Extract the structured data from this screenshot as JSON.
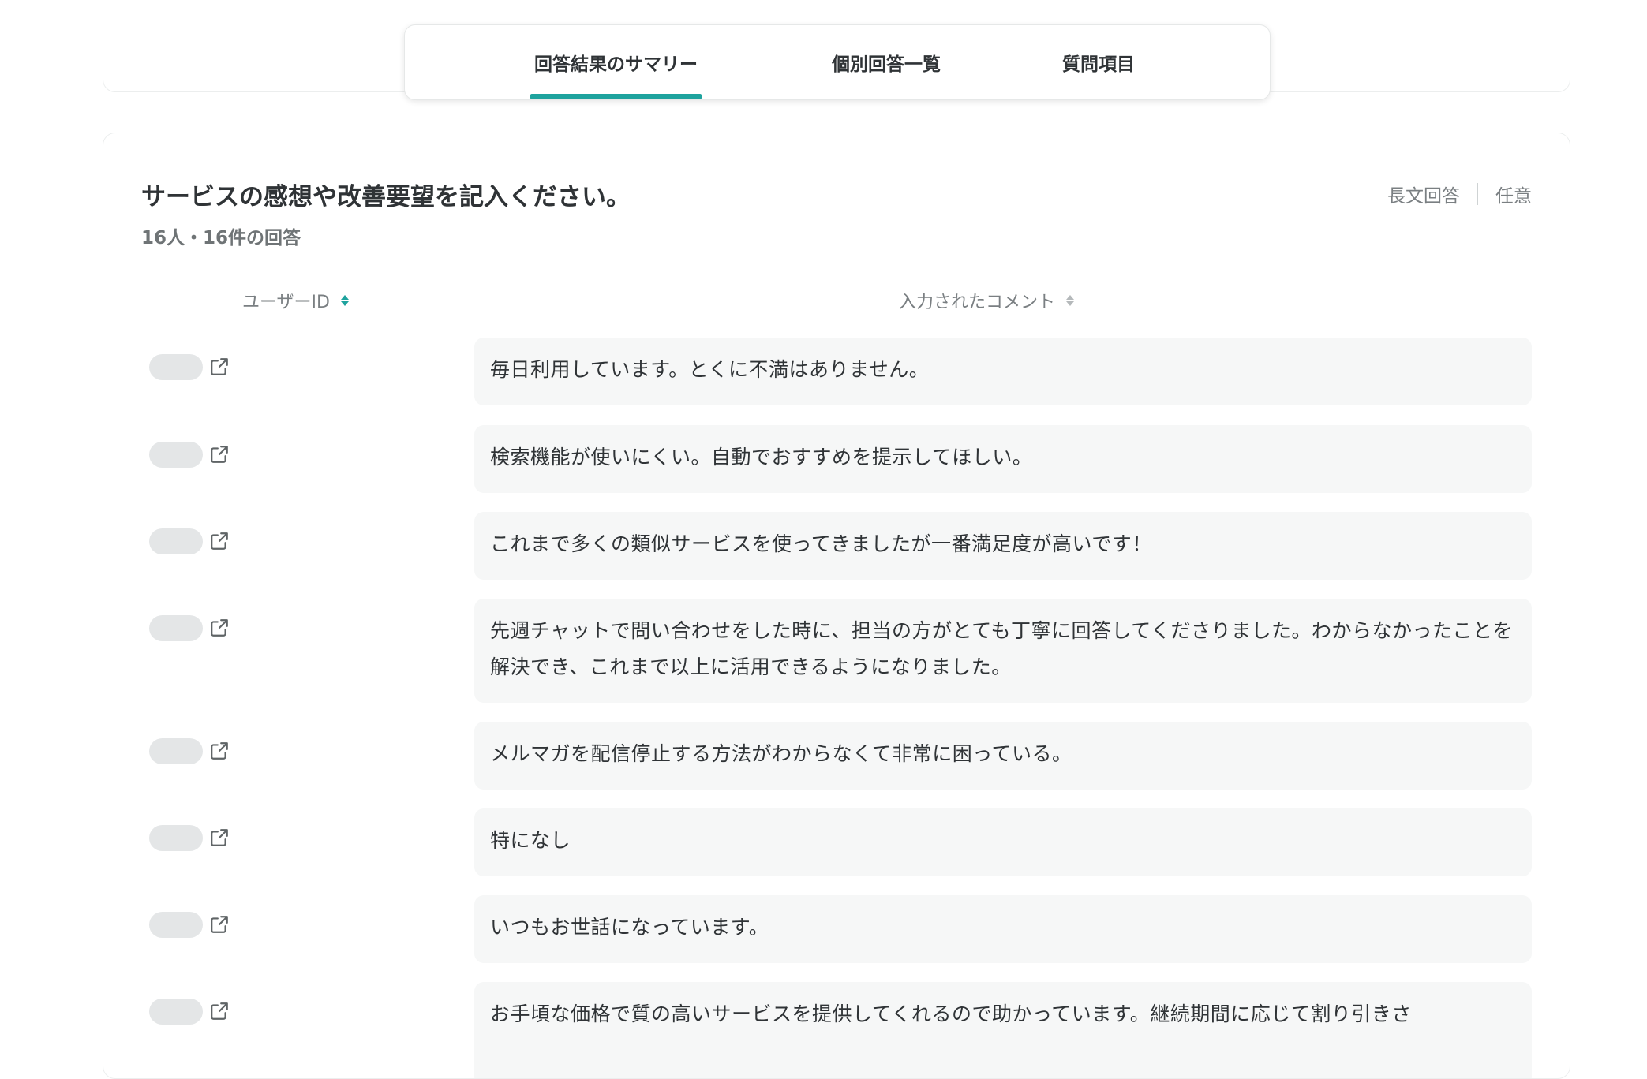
{
  "tabs": [
    {
      "label": "回答結果のサマリー",
      "active": true
    },
    {
      "label": "個別回答一覧",
      "active": false
    },
    {
      "label": "質問項目",
      "active": false
    }
  ],
  "question": {
    "title": "サービスの感想や改善要望を記入ください。",
    "count": "16人・16件の回答",
    "type": "長文回答",
    "required": "任意"
  },
  "columns": {
    "user_id": "ユーザーID",
    "comment": "入力されたコメント"
  },
  "rows": [
    {
      "comment": "毎日利用しています。とくに不満はありません。"
    },
    {
      "comment": "検索機能が使いにくい。自動でおすすめを提示してほしい。"
    },
    {
      "comment": "これまで多くの類似サービスを使ってきましたが一番満足度が高いです！"
    },
    {
      "comment": "先週チャットで問い合わせをした時に、担当の方がとても丁寧に回答してくださりました。わからなかったことを解決でき、これまで以上に活用できるようになりました。"
    },
    {
      "comment": "メルマガを配信停止する方法がわからなくて非常に困っている。"
    },
    {
      "comment": "特になし"
    },
    {
      "comment": "いつもお世話になっています。"
    },
    {
      "comment": "お手頃な価格で質の高いサービスを提供してくれるので助かっています。継続期間に応じて割り引きさ"
    }
  ],
  "colors": {
    "accent": "#1ea39e",
    "text": "#2f3336",
    "muted": "#7a7f82",
    "comment_bg": "#f6f7f7"
  },
  "icons": {
    "external_link": "external-link-icon",
    "sort": "sort-icon"
  }
}
